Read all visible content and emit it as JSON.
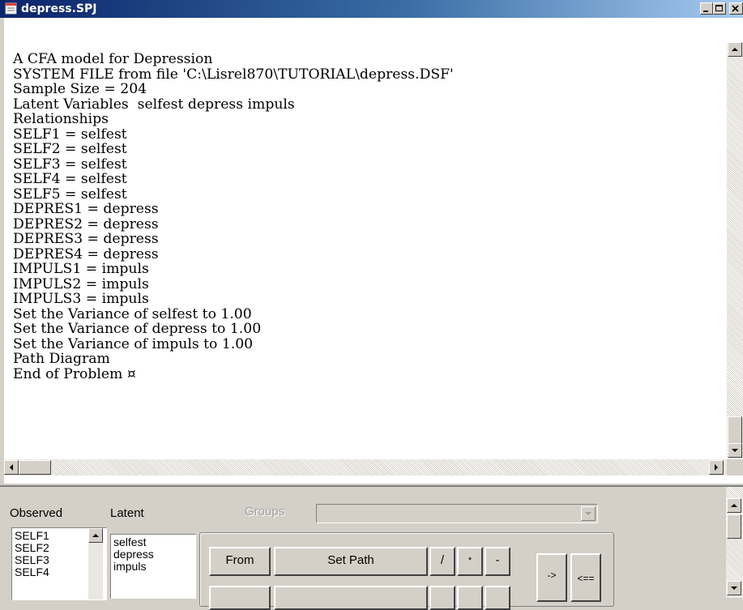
{
  "window": {
    "title": "depress.SPJ"
  },
  "editor": {
    "lines": [
      "A CFA model for Depression",
      "SYSTEM FILE from file 'C:\\Lisrel870\\TUTORIAL\\depress.DSF'",
      "Sample Size = 204",
      "Latent Variables  selfest depress impuls",
      "Relationships",
      "SELF1 = selfest",
      "SELF2 = selfest",
      "SELF3 = selfest",
      "SELF4 = selfest",
      "SELF5 = selfest",
      "DEPRES1 = depress",
      "DEPRES2 = depress",
      "DEPRES3 = depress",
      "DEPRES4 = depress",
      "IMPULS1 = impuls",
      "IMPULS2 = impuls",
      "IMPULS3 = impuls",
      "Set the Variance of selfest to 1.00",
      "Set the Variance of depress to 1.00",
      "Set the Variance of impuls to 1.00",
      "Path Diagram",
      "End of Problem ¤"
    ]
  },
  "panel": {
    "observed_label": "Observed",
    "latent_label": "Latent",
    "groups_label": "Groups",
    "observed_items": [
      "SELF1",
      "SELF2",
      "SELF3",
      "SELF4"
    ],
    "latent_items": [
      "selfest",
      "depress",
      "impuls"
    ],
    "buttons": {
      "from": "From",
      "set_path": "Set Path",
      "slash": "/",
      "star": "*",
      "dash": "-",
      "arrow_right": "->",
      "arrow_left": "<=="
    }
  },
  "colors": {
    "titlebar_start": "#0a246a",
    "titlebar_end": "#a6caf0",
    "chrome": "#d4d0c8"
  }
}
